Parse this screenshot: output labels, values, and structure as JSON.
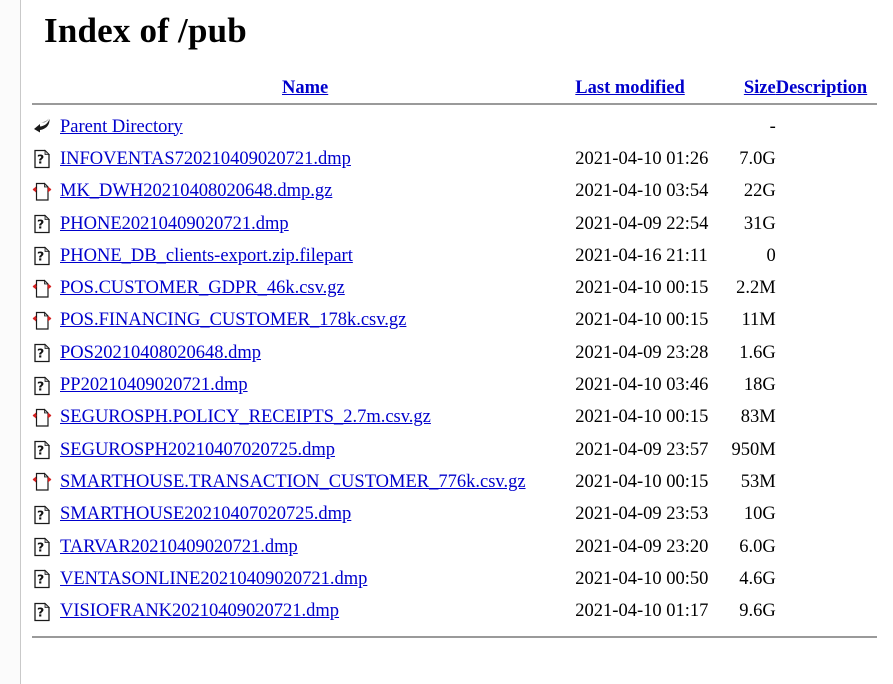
{
  "page": {
    "title": "Index of /pub"
  },
  "table": {
    "headers": {
      "name": "Name",
      "last_modified": "Last modified",
      "size": "Size",
      "description": "Description"
    },
    "rows": [
      {
        "icon": "parent-directory-icon",
        "name": "Parent Directory",
        "last_modified": "",
        "size": "-",
        "description": ""
      },
      {
        "icon": "unknown-file-icon",
        "name": "INFOVENTAS720210409020721.dmp",
        "last_modified": "2021-04-10 01:26",
        "size": "7.0G",
        "description": ""
      },
      {
        "icon": "compressed-file-icon",
        "name": "MK_DWH20210408020648.dmp.gz",
        "last_modified": "2021-04-10 03:54",
        "size": "22G",
        "description": ""
      },
      {
        "icon": "unknown-file-icon",
        "name": "PHONE20210409020721.dmp",
        "last_modified": "2021-04-09 22:54",
        "size": "31G",
        "description": ""
      },
      {
        "icon": "unknown-file-icon",
        "name": "PHONE_DB_clients-export.zip.filepart",
        "last_modified": "2021-04-16 21:11",
        "size": "0",
        "description": ""
      },
      {
        "icon": "compressed-file-icon",
        "name": "POS.CUSTOMER_GDPR_46k.csv.gz",
        "last_modified": "2021-04-10 00:15",
        "size": "2.2M",
        "description": ""
      },
      {
        "icon": "compressed-file-icon",
        "name": "POS.FINANCING_CUSTOMER_178k.csv.gz",
        "last_modified": "2021-04-10 00:15",
        "size": "11M",
        "description": ""
      },
      {
        "icon": "unknown-file-icon",
        "name": "POS20210408020648.dmp",
        "last_modified": "2021-04-09 23:28",
        "size": "1.6G",
        "description": ""
      },
      {
        "icon": "unknown-file-icon",
        "name": "PP20210409020721.dmp",
        "last_modified": "2021-04-10 03:46",
        "size": "18G",
        "description": ""
      },
      {
        "icon": "compressed-file-icon",
        "name": "SEGUROSPH.POLICY_RECEIPTS_2.7m.csv.gz",
        "last_modified": "2021-04-10 00:15",
        "size": "83M",
        "description": ""
      },
      {
        "icon": "unknown-file-icon",
        "name": "SEGUROSPH20210407020725.dmp",
        "last_modified": "2021-04-09 23:57",
        "size": "950M",
        "description": ""
      },
      {
        "icon": "compressed-file-icon",
        "name": "SMARTHOUSE.TRANSACTION_CUSTOMER_776k.csv.gz",
        "last_modified": "2021-04-10 00:15",
        "size": "53M",
        "description": ""
      },
      {
        "icon": "unknown-file-icon",
        "name": "SMARTHOUSE20210407020725.dmp",
        "last_modified": "2021-04-09 23:53",
        "size": "10G",
        "description": ""
      },
      {
        "icon": "unknown-file-icon",
        "name": "TARVAR20210409020721.dmp",
        "last_modified": "2021-04-09 23:20",
        "size": "6.0G",
        "description": ""
      },
      {
        "icon": "unknown-file-icon",
        "name": "VENTASONLINE20210409020721.dmp",
        "last_modified": "2021-04-10 00:50",
        "size": "4.6G",
        "description": ""
      },
      {
        "icon": "unknown-file-icon",
        "name": "VISIOFRANK20210409020721.dmp",
        "last_modified": "2021-04-10 01:17",
        "size": "9.6G",
        "description": ""
      }
    ]
  },
  "colors": {
    "link": "#0000cc",
    "text": "#000000",
    "rule": "#9a9a9a",
    "compressed_icon_accent": "#d42020",
    "background": "#ffffff"
  }
}
